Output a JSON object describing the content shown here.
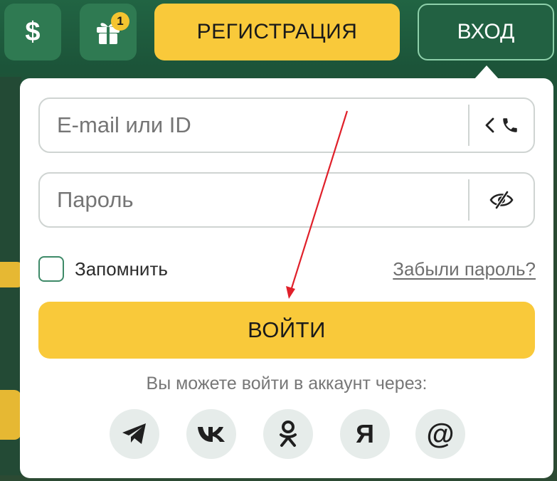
{
  "header": {
    "deposit_icon_glyph": "$",
    "gift_badge_count": "1",
    "register_label": "РЕГИСТРАЦИЯ",
    "login_label": "ВХОД"
  },
  "login_popup": {
    "email_placeholder": "E-mail или ID",
    "password_placeholder": "Пароль",
    "remember_label": "Запомнить",
    "forgot_label": "Забыли пароль?",
    "submit_label": "ВОЙТИ",
    "social_caption": "Вы можете войти в аккаунт через:",
    "social_providers": [
      {
        "name": "telegram",
        "icon": "telegram-icon"
      },
      {
        "name": "vk",
        "icon": "vk-icon"
      },
      {
        "name": "odnoklassniki",
        "icon": "odnoklassniki-icon"
      },
      {
        "name": "yandex",
        "icon": "yandex-icon",
        "glyph": "Я"
      },
      {
        "name": "mail",
        "icon": "mail-at-icon",
        "glyph": "@"
      }
    ]
  },
  "colors": {
    "header_bg": "#216443",
    "accent_yellow": "#f9c93a",
    "login_border": "#8ed0aa",
    "annotation_arrow": "#e0202a"
  }
}
